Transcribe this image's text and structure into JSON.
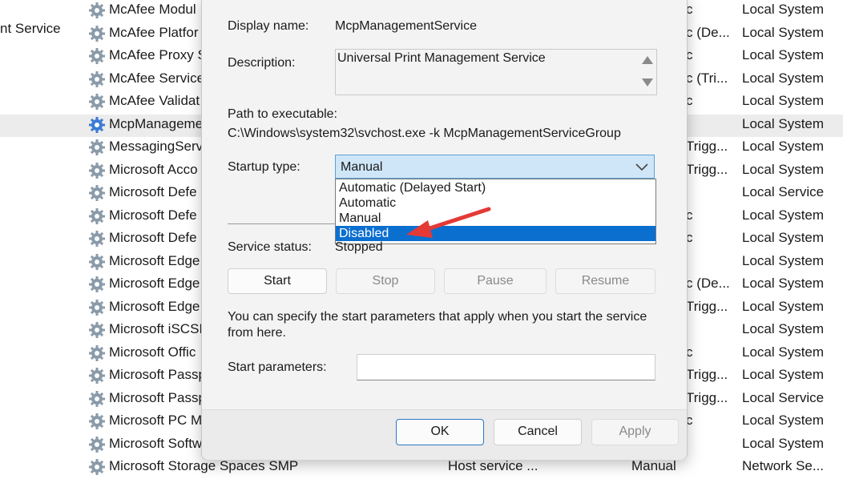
{
  "background": {
    "left_fragment": "nt Service",
    "rows": [
      {
        "name": "McAfee Modul",
        "status_frag": "c",
        "logon": "Local System"
      },
      {
        "name": "McAfee Platfor",
        "status_frag": "c (De...",
        "logon": "Local System"
      },
      {
        "name": "McAfee Proxy S",
        "status_frag": "c",
        "logon": "Local System"
      },
      {
        "name": "McAfee Service",
        "status_frag": "c (Tri...",
        "logon": "Local System"
      },
      {
        "name": "McAfee Validat",
        "status_frag": "c",
        "logon": "Local System"
      },
      {
        "name": "McpManageme",
        "status_frag": "",
        "logon": "Local System"
      },
      {
        "name": "MessagingServ",
        "status_frag": "Trigg...",
        "logon": "Local System"
      },
      {
        "name": "Microsoft Acco",
        "status_frag": "Trigg...",
        "logon": "Local System"
      },
      {
        "name": "Microsoft Defe",
        "status_frag": "",
        "logon": "Local Service"
      },
      {
        "name": "Microsoft Defe",
        "status_frag": "c",
        "logon": "Local System"
      },
      {
        "name": "Microsoft Defe",
        "status_frag": "c",
        "logon": "Local System"
      },
      {
        "name": "Microsoft Edge",
        "status_frag": "",
        "logon": "Local System"
      },
      {
        "name": "Microsoft Edge",
        "status_frag": "c (De...",
        "logon": "Local System"
      },
      {
        "name": "Microsoft Edge",
        "status_frag": "Trigg...",
        "logon": "Local System"
      },
      {
        "name": "Microsoft iSCSI",
        "status_frag": "",
        "logon": "Local System"
      },
      {
        "name": "Microsoft Offic",
        "status_frag": "c",
        "logon": "Local System"
      },
      {
        "name": "Microsoft Passp",
        "status_frag": "Trigg...",
        "logon": "Local System"
      },
      {
        "name": "Microsoft Passp",
        "status_frag": "Trigg...",
        "logon": "Local Service"
      },
      {
        "name": "Microsoft PC M",
        "status_frag": "c",
        "logon": "Local System"
      },
      {
        "name": "Microsoft Softw",
        "status_frag": "",
        "logon": "Local System"
      },
      {
        "name": "Microsoft Storage Spaces SMP",
        "desc": "Host service ...",
        "startup": "Manual",
        "status_frag": "",
        "logon": "Network Se..."
      }
    ]
  },
  "dialog": {
    "display_name_label": "Display name:",
    "display_name_value": "McpManagementService",
    "description_label": "Description:",
    "description_value": "Universal Print Management Service",
    "path_label": "Path to executable:",
    "path_value": "C:\\Windows\\system32\\svchost.exe -k McpManagementServiceGroup",
    "startup_type_label": "Startup type:",
    "startup_type_value": "Manual",
    "startup_options": [
      "Automatic (Delayed Start)",
      "Automatic",
      "Manual",
      "Disabled"
    ],
    "highlighted_option": "Disabled",
    "service_status_label": "Service status:",
    "service_status_value": "Stopped",
    "buttons": {
      "start": "Start",
      "stop": "Stop",
      "pause": "Pause",
      "resume": "Resume"
    },
    "hint_line1": "You can specify the start parameters that apply when you start the service",
    "hint_line2": "from here.",
    "start_params_label": "Start parameters:",
    "start_params_value": "",
    "footer": {
      "ok": "OK",
      "cancel": "Cancel",
      "apply": "Apply"
    }
  },
  "colors": {
    "selection_blue": "#0b6fd0",
    "combo_bg": "#cfe6f8",
    "annotation_arrow": "#e53935"
  }
}
